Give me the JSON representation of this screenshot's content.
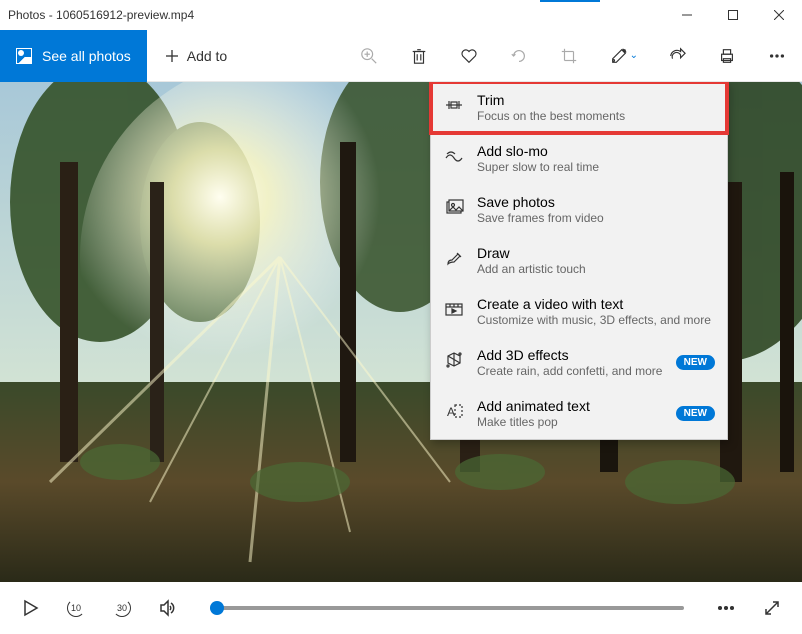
{
  "window": {
    "title": "Photos - 1060516912-preview.mp4"
  },
  "toolbar": {
    "see_all": "See all photos",
    "add_to": "Add to"
  },
  "menu": [
    {
      "title": "Trim",
      "sub": "Focus on the best moments",
      "icon": "trim-icon",
      "hl": true
    },
    {
      "title": "Add slo-mo",
      "sub": "Super slow to real time",
      "icon": "slomo-icon"
    },
    {
      "title": "Save photos",
      "sub": "Save frames from video",
      "icon": "saveframe-icon"
    },
    {
      "title": "Draw",
      "sub": "Add an artistic touch",
      "icon": "draw-icon"
    },
    {
      "title": "Create a video with text",
      "sub": "Customize with music, 3D effects, and more",
      "icon": "video-icon"
    },
    {
      "title": "Add 3D effects",
      "sub": "Create rain, add confetti, and more",
      "icon": "effects-icon",
      "badge": "NEW"
    },
    {
      "title": "Add animated text",
      "sub": "Make titles pop",
      "icon": "animtext-icon",
      "badge": "NEW"
    }
  ],
  "skip": {
    "back": "10",
    "fwd": "30"
  }
}
